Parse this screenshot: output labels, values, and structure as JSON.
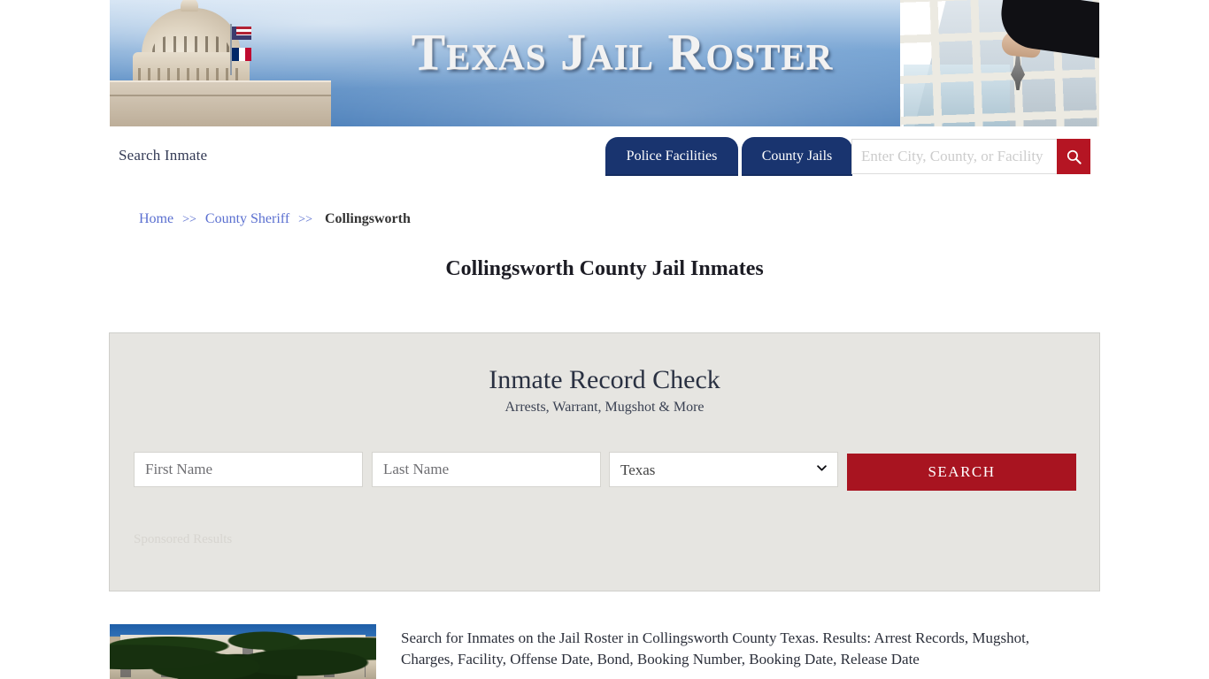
{
  "banner": {
    "title": "Texas Jail Roster",
    "alt_left": "texas-capitol-dome",
    "alt_right": "jail-bars-hand-with-keys"
  },
  "navbar": {
    "brand_label": "Search Inmate",
    "tabs": [
      {
        "label": "Police Facilities",
        "active": true
      },
      {
        "label": "County Jails",
        "active": true
      }
    ],
    "search": {
      "placeholder": "Enter City, County, or Facility",
      "value": "",
      "button_icon": "search-icon",
      "button_color": "#b51523"
    }
  },
  "breadcrumb": {
    "items": [
      {
        "label": "Home",
        "link": true
      },
      {
        "label": "County Sheriff",
        "link": true
      },
      {
        "label": "Collingsworth",
        "link": false
      }
    ],
    "separator": ">>"
  },
  "page": {
    "title": "Collingsworth County Jail Inmates"
  },
  "record_check": {
    "title": "Inmate Record Check",
    "subtitle": "Arrests, Warrant, Mugshot & More",
    "first_name_placeholder": "First Name",
    "first_name_value": "",
    "last_name_placeholder": "Last Name",
    "last_name_value": "",
    "state_selected": "Texas",
    "state_options": [
      "Texas"
    ],
    "search_button_label": "SEARCH",
    "search_button_color": "#a81420",
    "sponsored_label": "Sponsored Results",
    "panel_bg": "#e6e5e1"
  },
  "result": {
    "thumbnail_alt": "collingsworth-county-courthouse",
    "description": "Search for Inmates on the Jail Roster in Collingsworth County Texas. Results: Arrest Records, Mugshot, Charges, Facility, Offense Date, Bond, Booking Number, Booking Date, Release Date"
  },
  "colors": {
    "nav_blue": "#19346f",
    "accent_red": "#b51523",
    "link_blue": "#5a6fd0"
  }
}
